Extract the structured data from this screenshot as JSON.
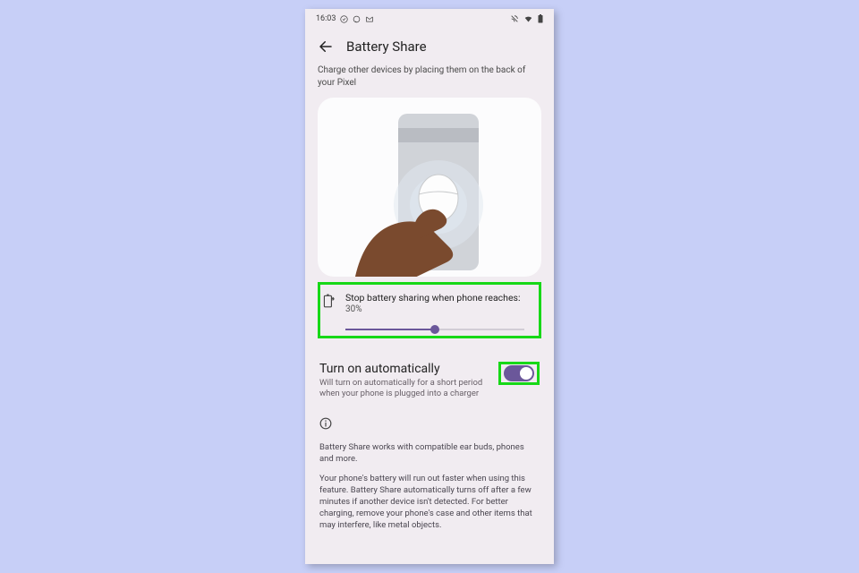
{
  "statusbar": {
    "time": "16:03"
  },
  "appbar": {
    "title": "Battery Share"
  },
  "description": "Charge other devices by placing them on the back of your Pixel",
  "threshold": {
    "label": "Stop battery sharing when phone reaches:",
    "value": "30%",
    "percent": 50
  },
  "auto": {
    "title": "Turn on automatically",
    "sub": "Will turn on automatically for a short period when your phone is plugged into a charger",
    "enabled": true
  },
  "info": {
    "p1": "Battery Share works with compatible ear buds, phones and more.",
    "p2": "Your phone's battery will run out faster when using this feature. Battery Share automatically turns off after a few minutes if another device isn't detected. For better charging, remove your phone's case and other items that may interfere, like metal objects."
  }
}
